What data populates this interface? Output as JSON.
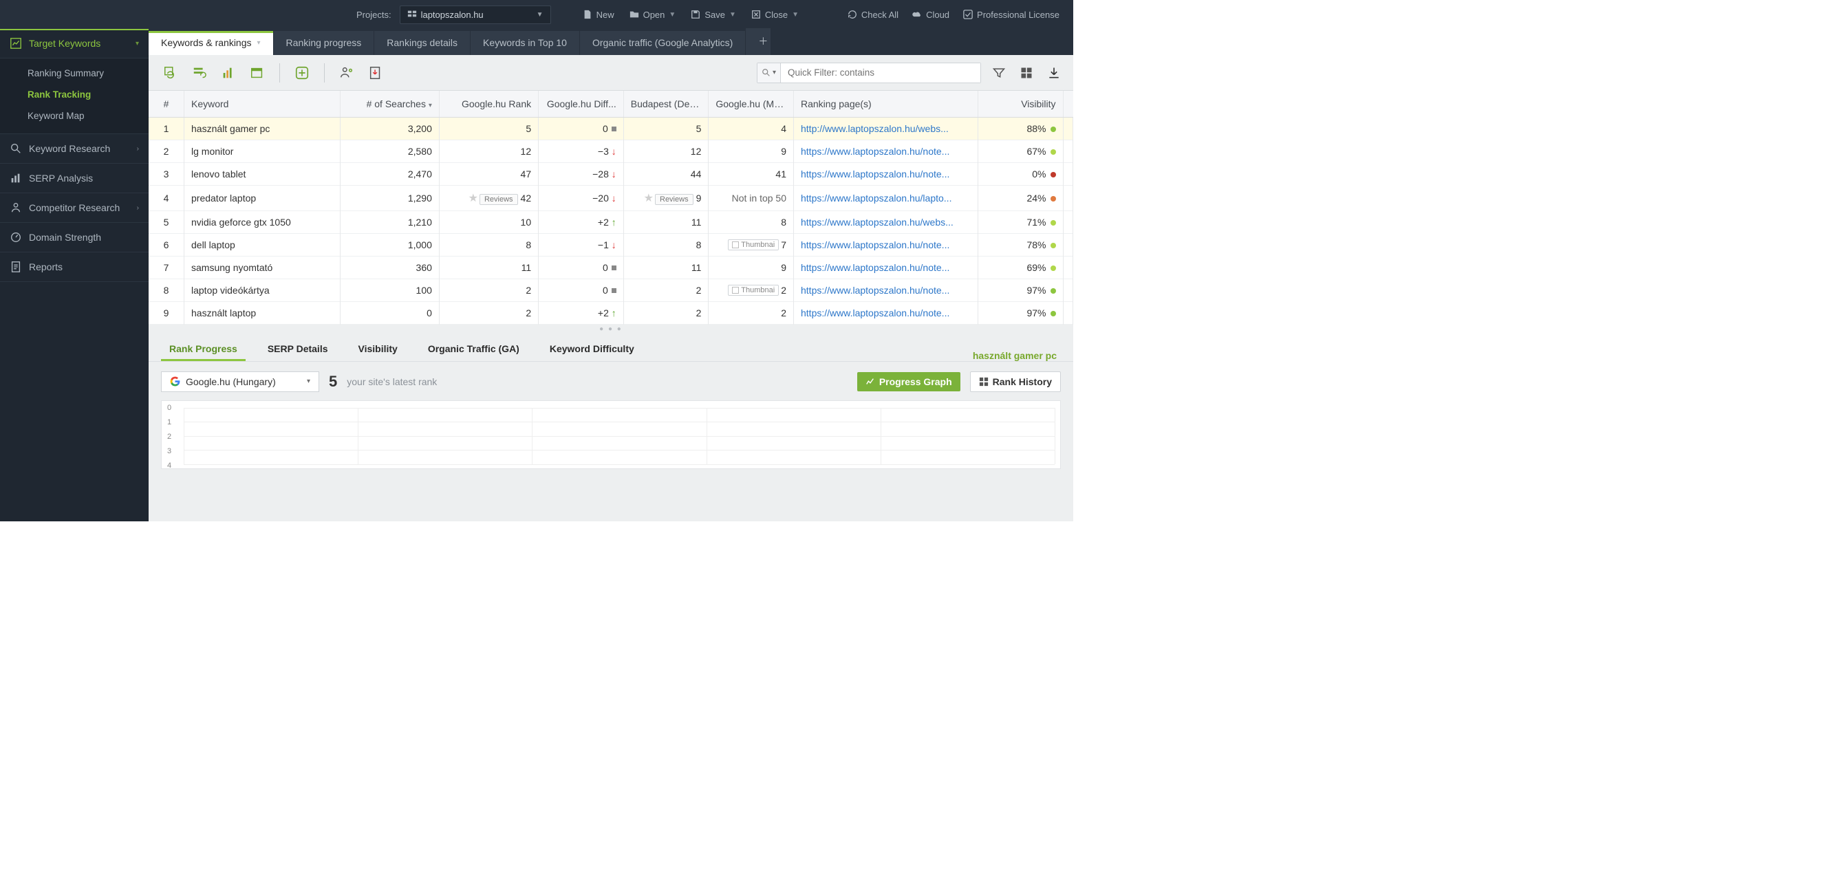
{
  "topbar": {
    "projects_label": "Projects:",
    "project_name": "laptopszalon.hu",
    "buttons": {
      "new": "New",
      "open": "Open",
      "save": "Save",
      "close": "Close",
      "check_all": "Check All",
      "cloud": "Cloud",
      "license": "Professional License"
    }
  },
  "sidebar": {
    "target_keywords": "Target Keywords",
    "subitems": {
      "ranking_summary": "Ranking Summary",
      "rank_tracking": "Rank Tracking",
      "keyword_map": "Keyword Map"
    },
    "keyword_research": "Keyword Research",
    "serp_analysis": "SERP Analysis",
    "competitor_research": "Competitor Research",
    "domain_strength": "Domain Strength",
    "reports": "Reports"
  },
  "tabs": {
    "keywords_rankings": "Keywords & rankings",
    "ranking_progress": "Ranking progress",
    "rankings_details": "Rankings details",
    "keywords_top10": "Keywords in Top 10",
    "organic_ga": "Organic traffic (Google Analytics)"
  },
  "toolbar": {
    "filter_placeholder": "Quick Filter: contains"
  },
  "columns": {
    "idx": "#",
    "keyword": "Keyword",
    "searches": "# of Searches",
    "rank": "Google.hu Rank",
    "diff": "Google.hu Diff...",
    "budapest": "Budapest (Des...",
    "mo": "Google.hu (Mo...",
    "pages": "Ranking page(s)",
    "visibility": "Visibility"
  },
  "chips": {
    "reviews": "Reviews",
    "thumbnail": "Thumbnai",
    "notintop": "Not in top 50"
  },
  "rows": [
    {
      "n": 1,
      "kw": "használt gamer pc",
      "searches": "3,200",
      "rank": "5",
      "diff": "0",
      "diff_dir": "zero",
      "bud": "5",
      "mo": "4",
      "page": "http://www.laptopszalon.hu/webs...",
      "vis": "88%",
      "dot": "dot-green",
      "sel": true
    },
    {
      "n": 2,
      "kw": "lg monitor",
      "searches": "2,580",
      "rank": "12",
      "diff": "−3",
      "diff_dir": "down",
      "bud": "12",
      "mo": "9",
      "page": "https://www.laptopszalon.hu/note...",
      "vis": "67%",
      "dot": "dot-lime"
    },
    {
      "n": 3,
      "kw": "lenovo tablet",
      "searches": "2,470",
      "rank": "47",
      "diff": "−28",
      "diff_dir": "down",
      "bud": "44",
      "mo": "41",
      "page": "https://www.laptopszalon.hu/note...",
      "vis": "0%",
      "dot": "dot-red"
    },
    {
      "n": 4,
      "kw": "predator laptop",
      "searches": "1,290",
      "rank": "42",
      "rank_star": true,
      "rank_rev": true,
      "diff": "−20",
      "diff_dir": "down",
      "bud": "9",
      "bud_star": true,
      "bud_rev": true,
      "mo_text": "Not in top 50",
      "page": "https://www.laptopszalon.hu/lapto...",
      "vis": "24%",
      "dot": "dot-orange"
    },
    {
      "n": 5,
      "kw": "nvidia geforce gtx 1050",
      "searches": "1,210",
      "rank": "10",
      "diff": "+2",
      "diff_dir": "up",
      "bud": "11",
      "mo": "8",
      "page": "https://www.laptopszalon.hu/webs...",
      "vis": "71%",
      "dot": "dot-lime"
    },
    {
      "n": 6,
      "kw": "dell laptop",
      "searches": "1,000",
      "rank": "8",
      "diff": "−1",
      "diff_dir": "down",
      "bud": "8",
      "mo": "7",
      "mo_thumb": true,
      "page": "https://www.laptopszalon.hu/note...",
      "vis": "78%",
      "dot": "dot-lime"
    },
    {
      "n": 7,
      "kw": "samsung nyomtató",
      "searches": "360",
      "rank": "11",
      "diff": "0",
      "diff_dir": "zero",
      "bud": "11",
      "mo": "9",
      "page": "https://www.laptopszalon.hu/note...",
      "vis": "69%",
      "dot": "dot-lime"
    },
    {
      "n": 8,
      "kw": "laptop videókártya",
      "searches": "100",
      "rank": "2",
      "diff": "0",
      "diff_dir": "zero",
      "bud": "2",
      "mo": "2",
      "mo_thumb": true,
      "page": "https://www.laptopszalon.hu/note...",
      "vis": "97%",
      "dot": "dot-green"
    },
    {
      "n": 9,
      "kw": "használt laptop",
      "searches": "0",
      "rank": "2",
      "diff": "+2",
      "diff_dir": "up",
      "bud": "2",
      "mo": "2",
      "page": "https://www.laptopszalon.hu/note...",
      "vis": "97%",
      "dot": "dot-green"
    }
  ],
  "bottom": {
    "tabs": {
      "rank_progress": "Rank Progress",
      "serp_details": "SERP Details",
      "visibility": "Visibility",
      "organic_ga": "Organic Traffic (GA)",
      "kw_difficulty": "Keyword Difficulty"
    },
    "selected_keyword": "használt gamer pc",
    "se_select": "Google.hu (Hungary)",
    "rank_value": "5",
    "rank_caption": "your site's latest rank",
    "progress_btn": "Progress Graph",
    "history_btn": "Rank History",
    "y_ticks": [
      "0",
      "1",
      "2",
      "3",
      "4"
    ]
  }
}
